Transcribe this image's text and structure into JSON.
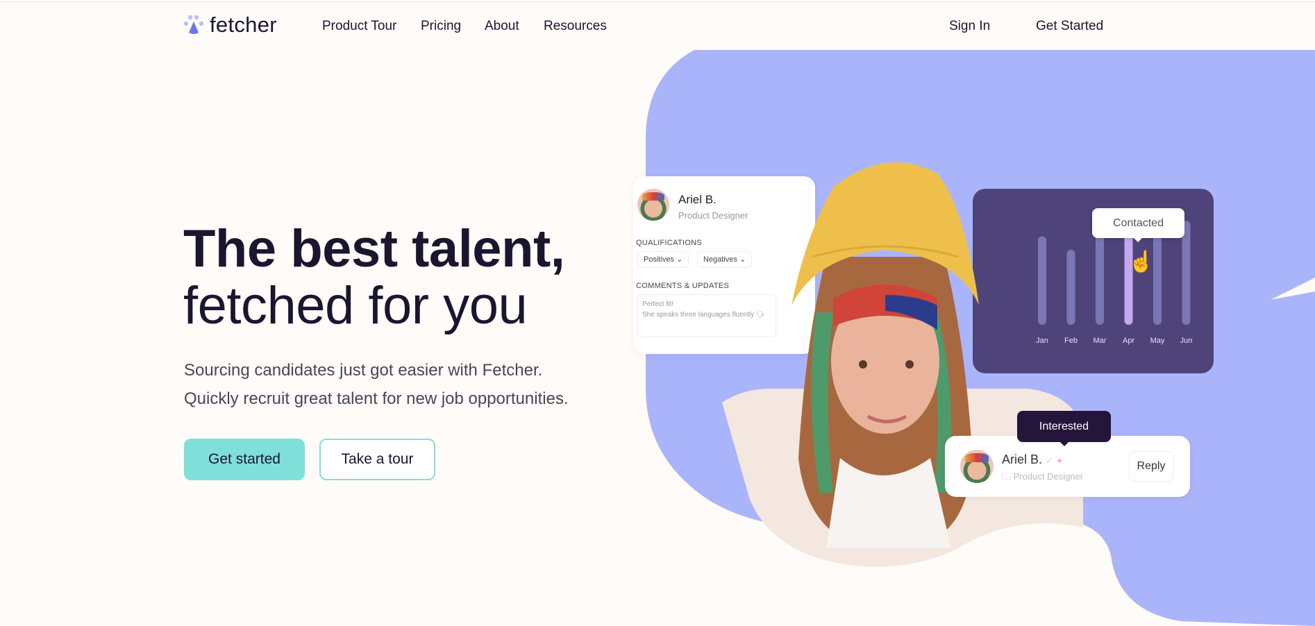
{
  "brand": {
    "name": "fetcher",
    "accent": "#7fe0da",
    "blob_color": "#aab4fb",
    "chart_bg": "#4e4479"
  },
  "nav": {
    "items": [
      "Product Tour",
      "Pricing",
      "About",
      "Resources"
    ],
    "sign_in": "Sign In",
    "get_started": "Get Started"
  },
  "hero": {
    "title_line1": "The best talent,",
    "title_line2": "fetched for you",
    "sub_line1": "Sourcing candidates just got easier with Fetcher.",
    "sub_line2": "Quickly recruit great talent for new job opportunities.",
    "primary_button": "Get started",
    "secondary_button": "Take a tour"
  },
  "profile_card": {
    "name": "Ariel B.",
    "role": "Product Designer",
    "qualifications_label": "QUALIFICATIONS",
    "positives": "Positives",
    "negatives": "Negatives",
    "comments_label": "COMMENTS & UPDATES",
    "comment_line1": "Perfect fit!",
    "comment_line2": "She speaks three languages fluently 🗣"
  },
  "chart_card": {
    "tooltip": "Contacted",
    "highlight": "Apr"
  },
  "chart_data": {
    "type": "bar",
    "categories": [
      "Jan",
      "Feb",
      "Mar",
      "Apr",
      "May",
      "Jun"
    ],
    "values": [
      0.85,
      0.72,
      0.92,
      0.92,
      0.88,
      1.0
    ],
    "highlight": "Apr"
  },
  "notification_card": {
    "badge": "Interested",
    "name": "Ariel B.",
    "role": "Product Designer",
    "reply": "Reply"
  }
}
